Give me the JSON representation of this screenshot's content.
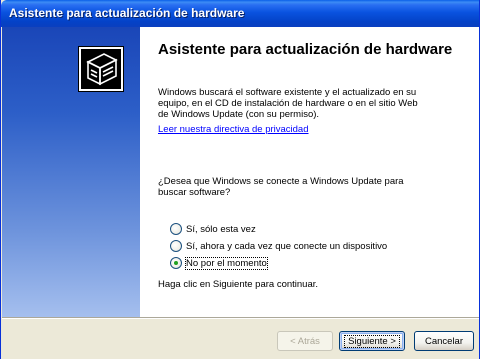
{
  "window": {
    "title": "Asistente para actualización de hardware"
  },
  "banner": {
    "icon": "hardware-device-icon"
  },
  "content": {
    "heading": "Asistente para actualización de hardware",
    "description": "Windows buscará el software existente y el actualizado en su equipo, en el CD de instalación de hardware o en el sitio Web de Windows Update (con su permiso).",
    "privacy_link": "Leer nuestra directiva de privacidad",
    "question": "¿Desea que Windows se conecte a Windows Update para buscar software?",
    "options": [
      {
        "label": "Sí, sólo esta vez",
        "checked": false
      },
      {
        "label": "Sí, ahora y cada vez que conecte un dispositivo",
        "checked": false
      },
      {
        "label": "No por el momento",
        "checked": true
      }
    ],
    "footer": "Haga clic en Siguiente para continuar."
  },
  "buttons": {
    "back": "< Atrás",
    "next": "Siguiente >",
    "cancel": "Cancelar"
  },
  "colors": {
    "titlebar": "#0a53e0",
    "window_bg": "#ece9d8",
    "link": "#0000ff",
    "radio_dot": "#21a121"
  }
}
